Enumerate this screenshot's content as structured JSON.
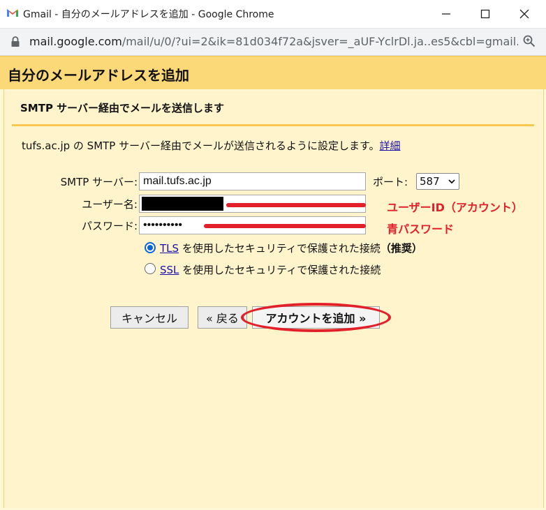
{
  "window": {
    "title": "Gmail - 自分のメールアドレスを追加 - Google Chrome",
    "url_host": "mail.google.com",
    "url_rest": "/mail/u/0/?ui=2&ik=81d034f72a&jsver=_aUF-YclrDl.ja..es5&cbl=gmail...."
  },
  "page": {
    "title": "自分のメールアドレスを追加",
    "subheading": "SMTP サーバー経由でメールを送信します",
    "description": "tufs.ac.jp の SMTP サーバー経由でメールが送信されるように設定します。",
    "details_link": "詳細"
  },
  "form": {
    "smtp_label": "SMTP サーバー:",
    "smtp_value": "mail.tufs.ac.jp",
    "port_label": "ポート:",
    "port_value": "587",
    "username_label": "ユーザー名:",
    "password_label": "パスワード:",
    "password_value": "••••••••••",
    "tls_link": "TLS",
    "tls_text": " を使用したセキュリティで保護された接続",
    "tls_recommended": "（推奨）",
    "ssl_link": "SSL",
    "ssl_text": " を使用したセキュリティで保護された接続",
    "selected_security": "TLS"
  },
  "annotations": {
    "username_note": "ユーザーID（アカウント）",
    "password_note": "青パスワード"
  },
  "buttons": {
    "cancel": "キャンセル",
    "back": "« 戻る",
    "add_account": "アカウントを追加 »"
  },
  "colors": {
    "header": "#fbd878",
    "panel": "#fff4cc",
    "annotation_red": "#e2202a",
    "link": "#1a0dab"
  },
  "icons": [
    "gmail-logo-icon",
    "minimize-icon",
    "maximize-icon",
    "close-icon",
    "lock-icon",
    "zoom-icon",
    "chevron-down-icon"
  ]
}
